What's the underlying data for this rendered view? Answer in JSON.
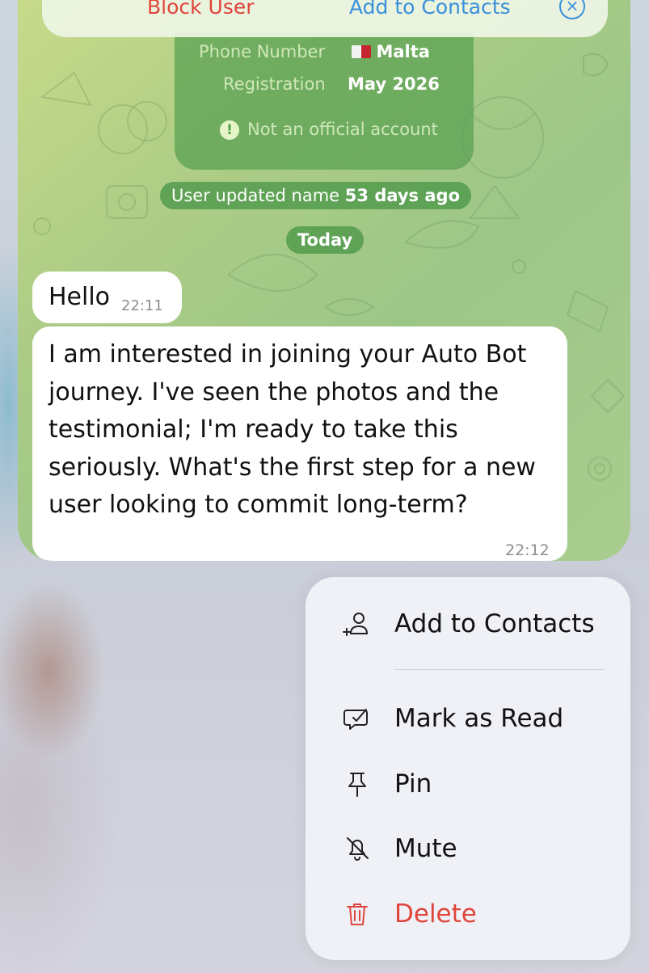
{
  "top_bar": {
    "block_label": "Block User",
    "add_label": "Add to Contacts",
    "close_glyph": "×"
  },
  "info_card": {
    "phone_label": "Phone Number",
    "phone_value": "Malta",
    "reg_label": "Registration",
    "reg_value": "May 2026",
    "warning_text": "Not an official account",
    "warning_glyph": "!"
  },
  "service": {
    "name_update_prefix": "User updated name",
    "name_update_age": "53 days ago",
    "date_divider": "Today"
  },
  "messages": [
    {
      "text": "Hello",
      "time": "22:11"
    },
    {
      "text": "I am interested in joining your Auto Bot journey. I've seen the photos and the testimonial; I'm ready to take this seriously. What's the first step for a new user looking to commit long-term?",
      "time": "22:12"
    }
  ],
  "context_menu": {
    "items": [
      {
        "label": "Add to Contacts",
        "icon": "add-contact-icon"
      },
      {
        "label": "Mark as Read",
        "icon": "mark-read-icon"
      },
      {
        "label": "Pin",
        "icon": "pin-icon"
      },
      {
        "label": "Mute",
        "icon": "mute-bell-icon"
      },
      {
        "label": "Delete",
        "icon": "trash-icon"
      }
    ]
  },
  "colors": {
    "destructive": "#e0453b",
    "link": "#3a8fdc",
    "service_green": "#4e984a"
  }
}
